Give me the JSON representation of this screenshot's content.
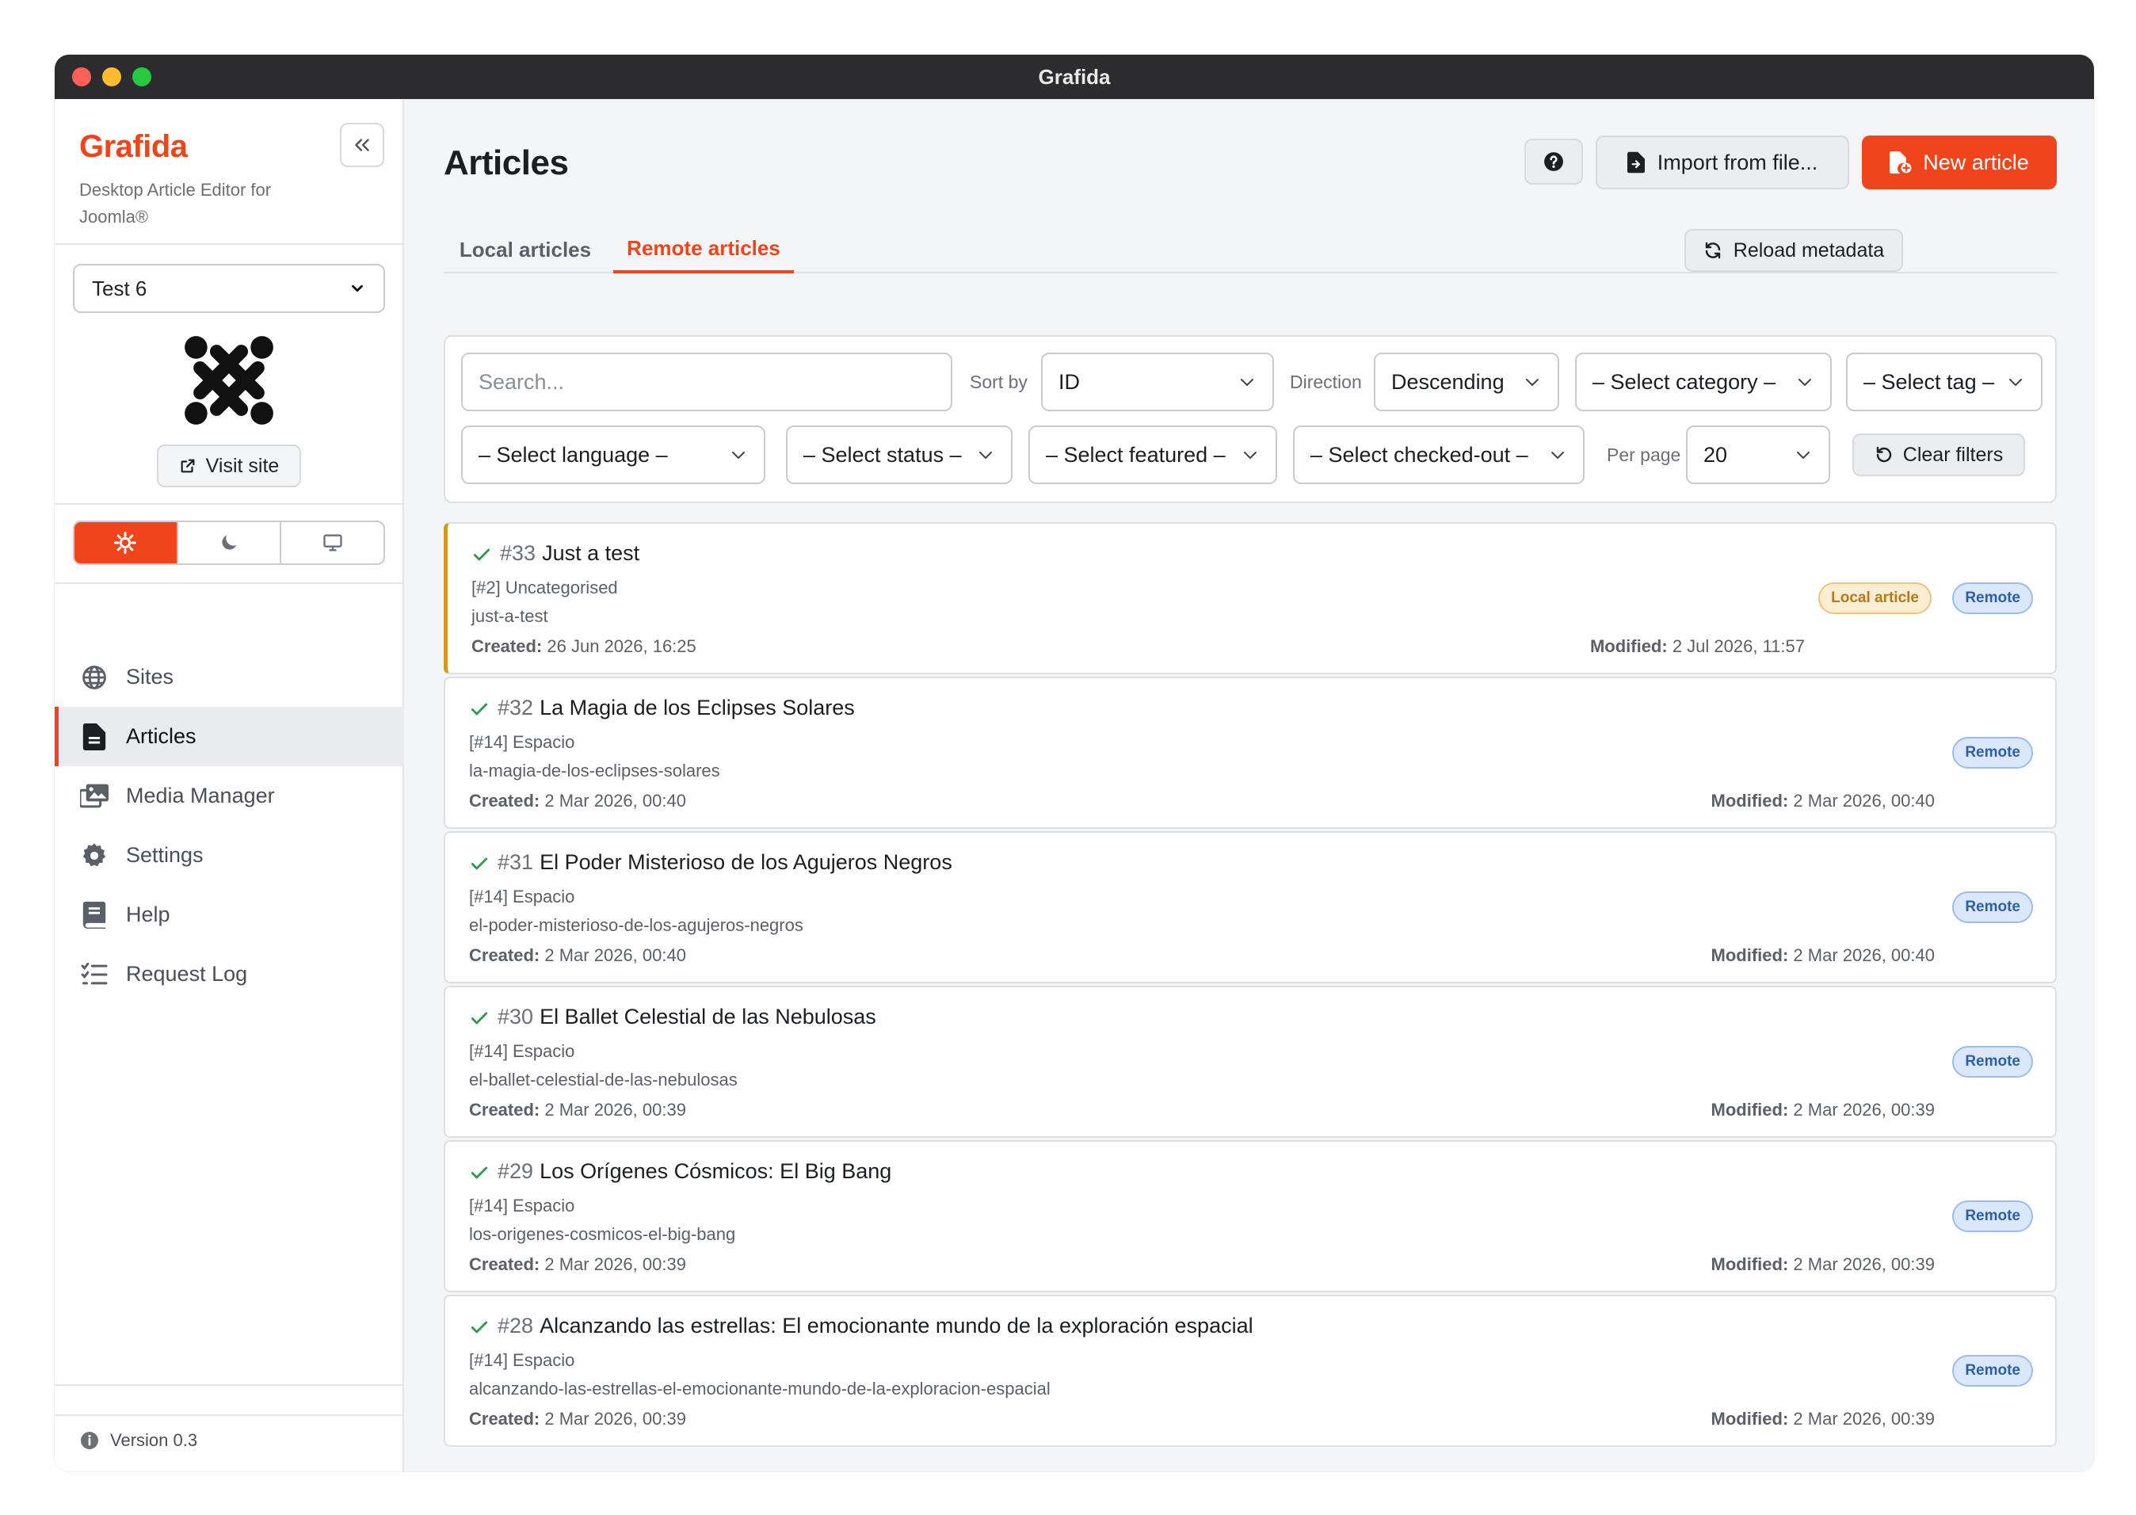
{
  "window": {
    "title": "Grafida"
  },
  "sidebar": {
    "brand": "Grafida",
    "tagline": "Desktop Article Editor for Joomla®",
    "site_select": "Test 6",
    "visit_site": "Visit site",
    "nav": [
      {
        "label": "Sites",
        "icon": "globe-icon"
      },
      {
        "label": "Articles",
        "icon": "file-text-icon"
      },
      {
        "label": "Media Manager",
        "icon": "images-icon"
      },
      {
        "label": "Settings",
        "icon": "gear-icon"
      },
      {
        "label": "Help",
        "icon": "book-icon"
      },
      {
        "label": "Request Log",
        "icon": "list-check-icon"
      }
    ],
    "active_nav": "Articles",
    "version": "Version 0.3"
  },
  "header": {
    "title": "Articles",
    "import_label": "Import from file...",
    "new_label": "New article"
  },
  "tabs": {
    "local": "Local articles",
    "remote": "Remote articles",
    "active": "Remote articles",
    "reload_label": "Reload metadata"
  },
  "filters": {
    "search_placeholder": "Search...",
    "sort_by_label": "Sort by",
    "sort_by_value": "ID",
    "direction_label": "Direction",
    "direction_value": "Descending",
    "category": "– Select category –",
    "tag": "– Select tag –",
    "language": "– Select language –",
    "status": "– Select status –",
    "featured": "– Select featured –",
    "checked_out": "– Select checked-out –",
    "per_page_label": "Per page",
    "per_page_value": "20",
    "clear_label": "Clear filters"
  },
  "articles": [
    {
      "id": "#33",
      "title": "Just a test",
      "category": "[#2] Uncategorised",
      "alias": "just-a-test",
      "created_label": "Created:",
      "created": "26 Jun 2026, 16:25",
      "modified_label": "Modified:",
      "modified": "2 Jul 2026, 11:57",
      "local_badge": "Local article",
      "remote_badge": "Remote"
    },
    {
      "id": "#32",
      "title": "La Magia de los Eclipses Solares",
      "category": "[#14] Espacio",
      "alias": "la-magia-de-los-eclipses-solares",
      "created_label": "Created:",
      "created": "2 Mar 2026, 00:40",
      "modified_label": "Modified:",
      "modified": "2 Mar 2026, 00:40",
      "remote_badge": "Remote"
    },
    {
      "id": "#31",
      "title": "El Poder Misterioso de los Agujeros Negros",
      "category": "[#14] Espacio",
      "alias": "el-poder-misterioso-de-los-agujeros-negros",
      "created_label": "Created:",
      "created": "2 Mar 2026, 00:40",
      "modified_label": "Modified:",
      "modified": "2 Mar 2026, 00:40",
      "remote_badge": "Remote"
    },
    {
      "id": "#30",
      "title": "El Ballet Celestial de las Nebulosas",
      "category": "[#14] Espacio",
      "alias": "el-ballet-celestial-de-las-nebulosas",
      "created_label": "Created:",
      "created": "2 Mar 2026, 00:39",
      "modified_label": "Modified:",
      "modified": "2 Mar 2026, 00:39",
      "remote_badge": "Remote"
    },
    {
      "id": "#29",
      "title": "Los Orígenes Cósmicos: El Big Bang",
      "category": "[#14] Espacio",
      "alias": "los-origenes-cosmicos-el-big-bang",
      "created_label": "Created:",
      "created": "2 Mar 2026, 00:39",
      "modified_label": "Modified:",
      "modified": "2 Mar 2026, 00:39",
      "remote_badge": "Remote"
    },
    {
      "id": "#28",
      "title": "Alcanzando las estrellas: El emocionante mundo de la exploración espacial",
      "category": "[#14] Espacio",
      "alias": "alcanzando-las-estrellas-el-emocionante-mundo-de-la-exploracion-espacial",
      "created_label": "Created:",
      "created": "2 Mar 2026, 00:39",
      "modified_label": "Modified:",
      "modified": "2 Mar 2026, 00:39",
      "remote_badge": "Remote"
    }
  ],
  "colors": {
    "accent": "#f0441a",
    "local_border": "#d19a1e",
    "remote_badge": "#dbe8fb"
  }
}
